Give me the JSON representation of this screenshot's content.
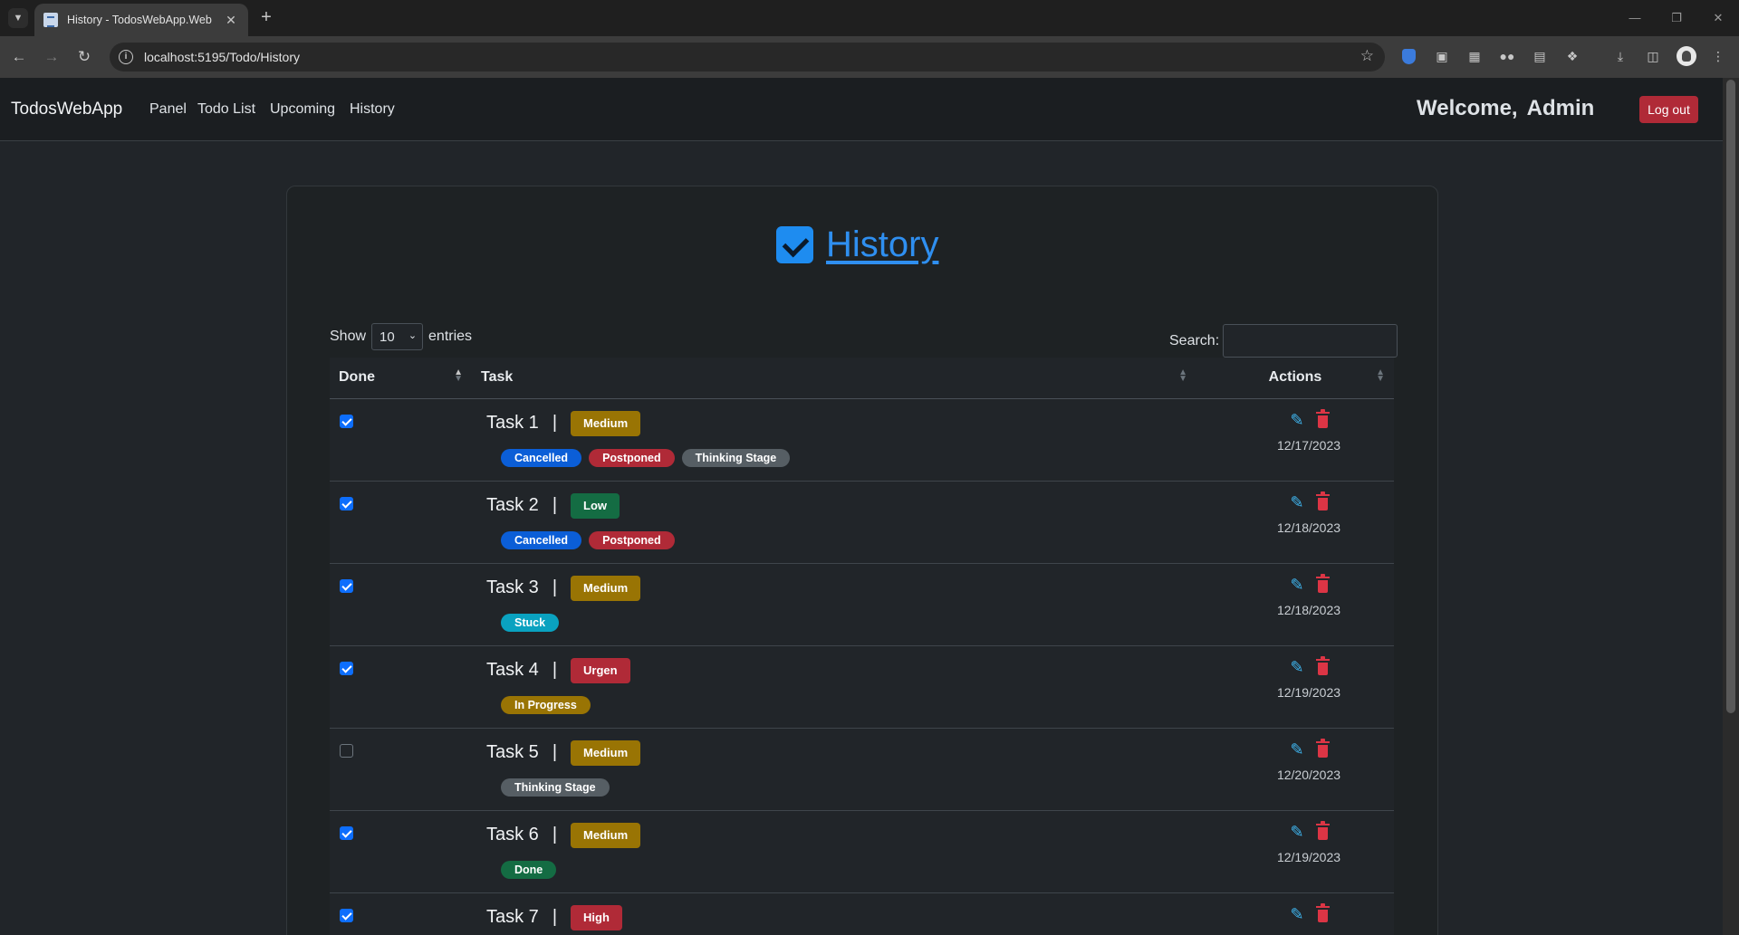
{
  "browser": {
    "tab_title": "History - TodosWebApp.Web",
    "url": "localhost:5195/Todo/History"
  },
  "navbar": {
    "brand": "TodosWebApp",
    "links": [
      "Panel",
      "Todo List",
      "Upcoming",
      "History"
    ],
    "welcome": "Welcome,",
    "user": "Admin",
    "logout": "Log out"
  },
  "page": {
    "title": "History",
    "show_label": "Show",
    "entries_value": "10",
    "entries_label": "entries",
    "search_label": "Search:",
    "search_value": ""
  },
  "table": {
    "columns": [
      "Done",
      "Task",
      "Actions"
    ],
    "rows": [
      {
        "done": true,
        "task": "Task 1",
        "priority": "Medium",
        "priority_color": "#997404",
        "tags": [
          {
            "label": "Cancelled",
            "color": "#0b5ed7"
          },
          {
            "label": "Postponed",
            "color": "#b02a37"
          },
          {
            "label": "Thinking Stage",
            "color": "#565e64"
          }
        ],
        "date": "12/17/2023"
      },
      {
        "done": true,
        "task": "Task 2",
        "priority": "Low",
        "priority_color": "#146c43",
        "tags": [
          {
            "label": "Cancelled",
            "color": "#0b5ed7"
          },
          {
            "label": "Postponed",
            "color": "#b02a37"
          }
        ],
        "date": "12/18/2023"
      },
      {
        "done": true,
        "task": "Task 3",
        "priority": "Medium",
        "priority_color": "#997404",
        "tags": [
          {
            "label": "Stuck",
            "color": "#0aa2c0"
          }
        ],
        "date": "12/18/2023"
      },
      {
        "done": true,
        "task": "Task 4",
        "priority": "Urgen",
        "priority_color": "#b02a37",
        "tags": [
          {
            "label": "In Progress",
            "color": "#997404"
          }
        ],
        "date": "12/19/2023"
      },
      {
        "done": false,
        "task": "Task 5",
        "priority": "Medium",
        "priority_color": "#997404",
        "tags": [
          {
            "label": "Thinking Stage",
            "color": "#565e64"
          }
        ],
        "date": "12/20/2023"
      },
      {
        "done": true,
        "task": "Task 6",
        "priority": "Medium",
        "priority_color": "#997404",
        "tags": [
          {
            "label": "Done",
            "color": "#146c43"
          }
        ],
        "date": "12/19/2023"
      },
      {
        "done": true,
        "task": "Task 7",
        "priority": "High",
        "priority_color": "#b02a37",
        "tags": [],
        "date": ""
      }
    ]
  },
  "colors": {
    "accent": "#2f8ff0",
    "logout": "#b02a37",
    "edit": "#3fb6f0",
    "delete": "#dc3545"
  }
}
